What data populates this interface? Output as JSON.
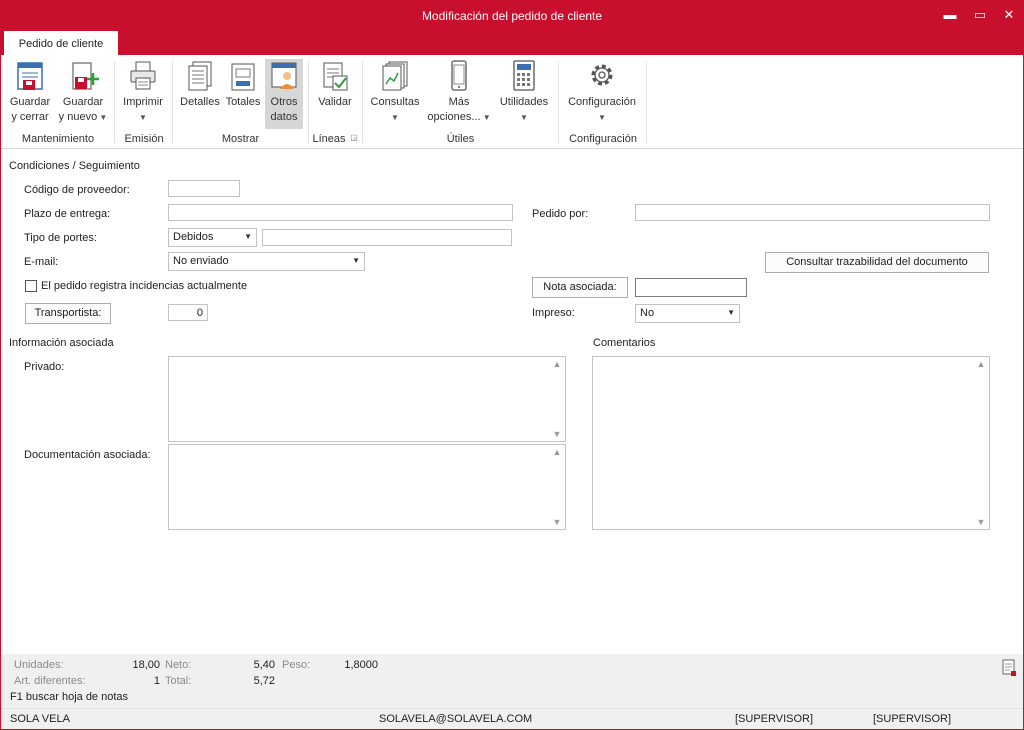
{
  "window": {
    "title": "Modificación del pedido de cliente",
    "minimize": "▬",
    "maximize": "▭",
    "close": "✕"
  },
  "tab": {
    "label": "Pedido de cliente"
  },
  "ribbon": {
    "buttons": {
      "guardar_cerrar": [
        "Guardar",
        "y cerrar"
      ],
      "guardar_nuevo": [
        "Guardar",
        "y nuevo"
      ],
      "imprimir": [
        "Imprimir"
      ],
      "detalles": [
        "Detalles"
      ],
      "totales": [
        "Totales"
      ],
      "otros_datos": [
        "Otros",
        "datos"
      ],
      "validar": [
        "Validar"
      ],
      "consultas": [
        "Consultas"
      ],
      "mas_opciones": [
        "Más",
        "opciones..."
      ],
      "utilidades": [
        "Utilidades"
      ],
      "configuracion": [
        "Configuración"
      ]
    },
    "groups": {
      "mantenimiento": "Mantenimiento",
      "emision": "Emisión",
      "mostrar": "Mostrar",
      "lineas": "Líneas",
      "utiles": "Útiles",
      "configuracion": "Configuración"
    }
  },
  "form": {
    "section_condiciones": "Condiciones / Seguimiento",
    "codigo_proveedor_label": "Código de proveedor:",
    "codigo_proveedor_value": "",
    "plazo_entrega_label": "Plazo de entrega:",
    "plazo_entrega_value": "",
    "pedido_por_label": "Pedido por:",
    "pedido_por_value": "",
    "tipo_portes_label": "Tipo de portes:",
    "tipo_portes_value": "Debidos",
    "tipo_portes_extra": "",
    "email_label": "E-mail:",
    "email_value": "No enviado",
    "consultar_trazabilidad": "Consultar trazabilidad del documento",
    "incidencias_label": "El pedido registra incidencias actualmente",
    "incidencias_checked": false,
    "nota_asociada_button": "Nota asociada:",
    "nota_asociada_value": "",
    "transportista_button": "Transportista:",
    "transportista_value": "0",
    "impreso_label": "Impreso:",
    "impreso_value": "No",
    "section_informacion": "Información asociada",
    "privado_label": "Privado:",
    "documentacion_label": "Documentación asociada:",
    "section_comentarios": "Comentarios"
  },
  "status": {
    "unidades_label": "Unidades:",
    "unidades_value": "18,00",
    "neto_label": "Neto:",
    "neto_value": "5,40",
    "peso_label": "Peso:",
    "peso_value": "1,8000",
    "art_diferentes_label": "Art. diferentes:",
    "art_diferentes_value": "1",
    "total_label": "Total:",
    "total_value": "5,72",
    "hint": "F1 buscar hoja de notas"
  },
  "footer": {
    "company": "SOLA VELA",
    "email": "SOLAVELA@SOLAVELA.COM",
    "user1": "[SUPERVISOR]",
    "user2": "[SUPERVISOR]"
  },
  "colors": {
    "accent": "#c8102e"
  }
}
